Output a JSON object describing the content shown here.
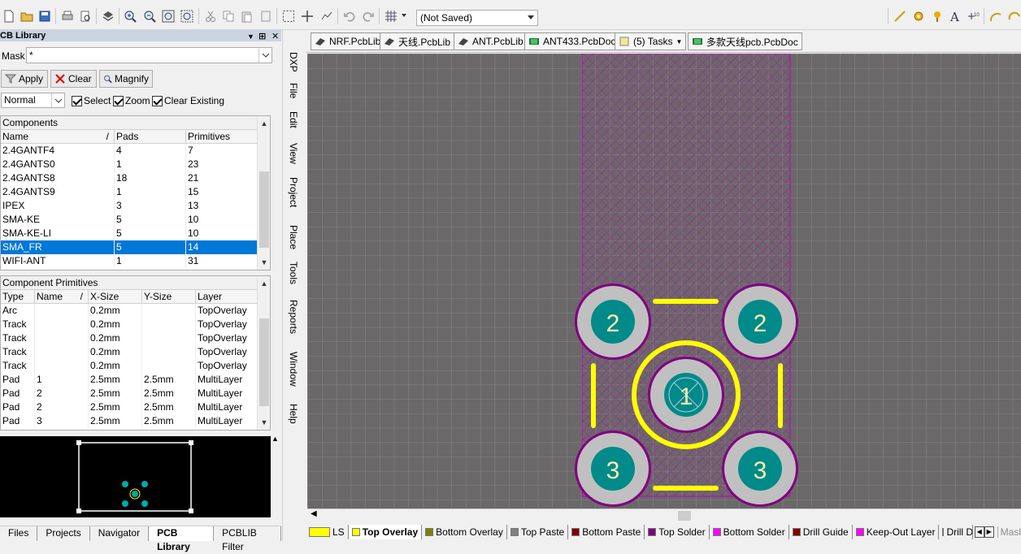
{
  "toolbar": {
    "save_state": "(Not Saved)"
  },
  "panel": {
    "title": "CB Library",
    "mask_label": "Mask",
    "mask_value": "*",
    "apply_label": "Apply",
    "clear_label": "Clear",
    "magnify_label": "Magnify",
    "mode_value": "Normal",
    "select_label": "Select",
    "zoom_label": "Zoom",
    "clear_existing_label": "Clear Existing"
  },
  "components": {
    "title": "Components",
    "headers": [
      "Name",
      "Pads",
      "Primitives"
    ],
    "sort_indicator": "/",
    "rows": [
      [
        "2.4GANTF4",
        "4",
        "7"
      ],
      [
        "2.4GANTS0",
        "1",
        "23"
      ],
      [
        "2.4GANTS8",
        "18",
        "21"
      ],
      [
        "2.4GANTS9",
        "1",
        "15"
      ],
      [
        "IPEX",
        "3",
        "13"
      ],
      [
        "SMA-KE",
        "5",
        "10"
      ],
      [
        "SMA-KE-LI",
        "5",
        "10"
      ],
      [
        "SMA_FR",
        "5",
        "14"
      ],
      [
        "WIFI-ANT",
        "1",
        "31"
      ]
    ],
    "selected_index": 7
  },
  "primitives": {
    "title": "Component Primitives",
    "headers": [
      "Type",
      "Name",
      "X-Size",
      "Y-Size",
      "Layer"
    ],
    "sort_indicator": "/",
    "rows": [
      [
        "Arc",
        "",
        "0.2mm",
        "",
        "TopOverlay"
      ],
      [
        "Track",
        "",
        "0.2mm",
        "",
        "TopOverlay"
      ],
      [
        "Track",
        "",
        "0.2mm",
        "",
        "TopOverlay"
      ],
      [
        "Track",
        "",
        "0.2mm",
        "",
        "TopOverlay"
      ],
      [
        "Track",
        "",
        "0.2mm",
        "",
        "TopOverlay"
      ],
      [
        "Pad",
        "1",
        "2.5mm",
        "2.5mm",
        "MultiLayer"
      ],
      [
        "Pad",
        "2",
        "2.5mm",
        "2.5mm",
        "MultiLayer"
      ],
      [
        "Pad",
        "2",
        "2.5mm",
        "2.5mm",
        "MultiLayer"
      ],
      [
        "Pad",
        "3",
        "2.5mm",
        "2.5mm",
        "MultiLayer"
      ]
    ]
  },
  "bottom_tabs": [
    "Files",
    "Projects",
    "Navigator",
    "PCB Library",
    "PCBLIB Filter"
  ],
  "vertical_menu": [
    "DXP",
    "File",
    "Edit",
    "View",
    "Project",
    "Place",
    "Tools",
    "Reports",
    "Window",
    "Help"
  ],
  "doc_tabs": [
    "NRF.PcbLib",
    "天线.PcbLib",
    "ANT.PcbLib",
    "ANT433.PcbDoc",
    "(5) Tasks",
    "多款天线pcb.PcbDoc"
  ],
  "pads": {
    "center": "1",
    "top_left": "2",
    "top_right": "2",
    "bottom_left": "3",
    "bottom_right": "3"
  },
  "layer_tabs": [
    {
      "label": "LS",
      "color": "#ffff00"
    },
    {
      "label": "Top Overlay",
      "color": "#ffff00"
    },
    {
      "label": "Bottom Overlay",
      "color": "#808000"
    },
    {
      "label": "Top Paste",
      "color": "#808080"
    },
    {
      "label": "Bottom Paste",
      "color": "#800000"
    },
    {
      "label": "Top Solder",
      "color": "#800080"
    },
    {
      "label": "Bottom Solder",
      "color": "#ff00ff"
    },
    {
      "label": "Drill Guide",
      "color": "#800000"
    },
    {
      "label": "Keep-Out Layer",
      "color": "#ff00ff"
    },
    {
      "label": "Drill Drawin",
      "color": "#e00030"
    }
  ],
  "mask_tail": "Masl",
  "colors": {
    "canvas": "#6a6868",
    "grid": "#878787",
    "overlay": "#ffff00",
    "pad_ring": "#c0c0c0",
    "pad_center": "#008a8a",
    "solder": "#800080",
    "hatch": "#c000c0",
    "selection": "#0078d7"
  }
}
